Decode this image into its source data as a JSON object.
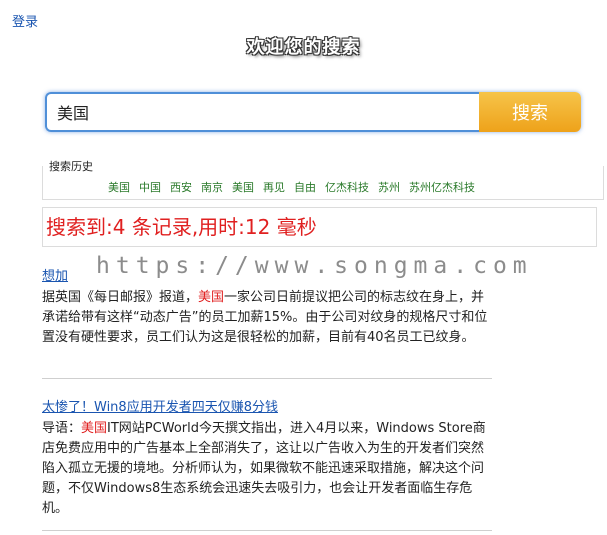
{
  "header": {
    "login_label": "登录",
    "title": "欢迎您的搜索"
  },
  "search": {
    "value": "美国",
    "button_label": "搜索"
  },
  "history": {
    "label": "搜索历史",
    "items": [
      "美国",
      "中国",
      "西安",
      "南京",
      "美国",
      "再见",
      "自由",
      "亿杰科技",
      "苏州",
      "苏州亿杰科技"
    ]
  },
  "stats": {
    "text": "搜索到:4 条记录,用时:12 毫秒"
  },
  "watermark": "https://www.songma.com",
  "results": [
    {
      "title": "想加",
      "snippet_pre": "据英国《每日邮报》报道，",
      "snippet_hl": "美国",
      "snippet_post": "一家公司日前提议把公司的标志纹在身上，并承诺给带有这样“动态广告”的员工加薪15%。由于公司对纹身的规格尺寸和位置没有硬性要求，员工们认为这是很轻松的加薪，目前有40名员工已纹身。"
    },
    {
      "title": "太惨了！Win8应用开发者四天仅赚8分钱",
      "snippet_pre": "导语：",
      "snippet_hl": "美国",
      "snippet_post": "IT网站PCWorld今天撰文指出，进入4月以来，Windows Store商店免费应用中的广告基本上全部消失了，这让以广告收入为生的开发者们突然陷入孤立无援的境地。分析师认为，如果微软不能迅速采取措施，解决这个问题，不仅Windows8生态系统会迅速失去吸引力，也会让开发者面临生存危机。"
    }
  ]
}
